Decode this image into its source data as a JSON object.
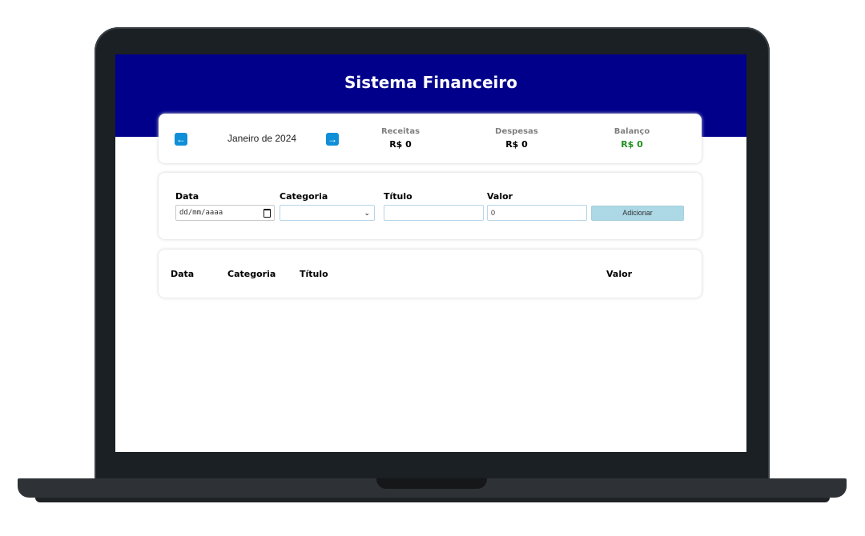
{
  "header": {
    "title": "Sistema Financeiro"
  },
  "summary": {
    "month_label": "Janeiro de 2024",
    "prev_icon": "arrow-left-icon",
    "next_icon": "arrow-right-icon",
    "prev_glyph": "←",
    "next_glyph": "→",
    "receitas_label": "Receitas",
    "receitas_value": "R$ 0",
    "despesas_label": "Despesas",
    "despesas_value": "R$ 0",
    "balanco_label": "Balanço",
    "balanco_value": "R$ 0",
    "balanco_color": "#1f8f1f"
  },
  "form": {
    "data_label": "Data",
    "data_placeholder": "dd/mm/aaaa",
    "categoria_label": "Categoria",
    "categoria_value": "",
    "titulo_label": "Título",
    "titulo_value": "",
    "valor_label": "Valor",
    "valor_value": "0",
    "add_button": "Adicionar"
  },
  "table": {
    "columns": [
      "Data",
      "Categoria",
      "Título",
      "Valor"
    ]
  },
  "colors": {
    "header_bg": "#00008b",
    "accent": "#0e8fd8",
    "button_bg": "#add8e6"
  }
}
